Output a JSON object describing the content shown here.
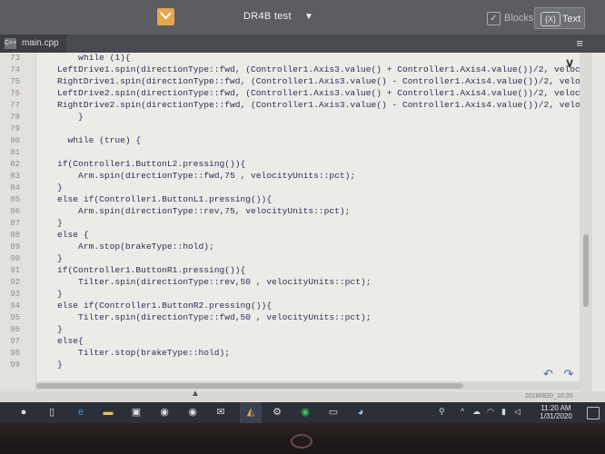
{
  "app": {
    "project_name": "DR4B test",
    "blocks_label": "Blocks",
    "text_label": "Text",
    "text_tag": "{X}",
    "file_icon_text": "C++",
    "file_tab": "main.cpp"
  },
  "editor": {
    "lines": [
      {
        "num": "73",
        "text": "        while (1){"
      },
      {
        "num": "74",
        "text": "    LeftDrive1.spin(directionType::fwd, (Controller1.Axis3.value() + Controller1.Axis4.value())/2, velocityUnits"
      },
      {
        "num": "75",
        "text": "    RightDrive1.spin(directionType::fwd, (Controller1.Axis3.value() - Controller1.Axis4.value())/2, velocityUni"
      },
      {
        "num": "76",
        "text": "    LeftDrive2.spin(directionType::fwd, (Controller1.Axis3.value() + Controller1.Axis4.value())/2, velocityUni"
      },
      {
        "num": "77",
        "text": "    RightDrive2.spin(directionType::fwd, (Controller1.Axis3.value() - Controller1.Axis4.value())/2, velocityUn"
      },
      {
        "num": "78",
        "text": "        }"
      },
      {
        "num": "79",
        "text": ""
      },
      {
        "num": "80",
        "text": "      while (true) {"
      },
      {
        "num": "81",
        "text": ""
      },
      {
        "num": "82",
        "text": "    if(Controller1.ButtonL2.pressing()){"
      },
      {
        "num": "83",
        "text": "        Arm.spin(directionType::fwd,75 , velocityUnits::pct);"
      },
      {
        "num": "84",
        "text": "    }"
      },
      {
        "num": "85",
        "text": "    else if(Controller1.ButtonL1.pressing()){"
      },
      {
        "num": "86",
        "text": "        Arm.spin(directionType::rev,75, velocityUnits::pct);"
      },
      {
        "num": "87",
        "text": "    }"
      },
      {
        "num": "88",
        "text": "    else {"
      },
      {
        "num": "89",
        "text": "        Arm.stop(brakeType::hold);"
      },
      {
        "num": "90",
        "text": "    }"
      },
      {
        "num": "91",
        "text": "    if(Controller1.ButtonR1.pressing()){"
      },
      {
        "num": "92",
        "text": "        Tilter.spin(directionType::rev,50 , velocityUnits::pct);"
      },
      {
        "num": "93",
        "text": "    }"
      },
      {
        "num": "94",
        "text": "    else if(Controller1.ButtonR2.pressing()){"
      },
      {
        "num": "95",
        "text": "        Tilter.spin(directionType::fwd,50 , velocityUnits::pct);"
      },
      {
        "num": "96",
        "text": "    }"
      },
      {
        "num": "97",
        "text": "    else{"
      },
      {
        "num": "98",
        "text": "        Tilter.stop(brakeType::hold);"
      },
      {
        "num": "99",
        "text": "    }"
      }
    ]
  },
  "status": {
    "stamp": "20180820_10:20"
  },
  "taskbar": {
    "time": "11:20 AM",
    "date": "1/31/2020"
  },
  "colors": {
    "editor_bg": "#ecebe7",
    "code_text": "#2e2f56",
    "toolbar": "#5b5d62",
    "accent": "#e7a54e"
  }
}
